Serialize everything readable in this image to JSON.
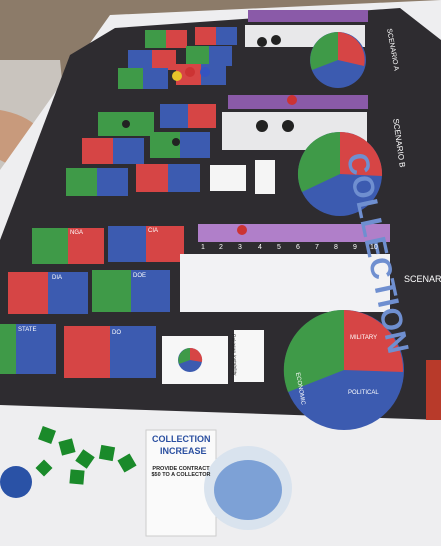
{
  "board": {
    "title": "COLLECTION",
    "scenarios": [
      "SCENARIO A",
      "SCENARIO B",
      "SCENARIO C"
    ],
    "track_numbers": [
      "1",
      "2",
      "3",
      "4",
      "5",
      "6",
      "7",
      "8",
      "9",
      "10"
    ],
    "region_labels": [
      "NGA",
      "DIA",
      "CIA",
      "DOE",
      "STATE",
      "DO"
    ],
    "pie_labels": [
      "MILITARY",
      "ECONOMIC",
      "POLITICAL"
    ],
    "event_card_title": "Pakistan Instability"
  },
  "table_card": {
    "title_line1": "COLLECTION",
    "title_line2": "INCREASE",
    "body": "PROVIDE CONTRACT $50 TO A COLLECTOR"
  },
  "colors": {
    "board_bg": "#2e2c30",
    "red": "#d64545",
    "blue": "#3c5bb0",
    "green": "#3f9a48",
    "table_cloth": "#f1f0f2",
    "title_blue": "#6f8fd0"
  }
}
